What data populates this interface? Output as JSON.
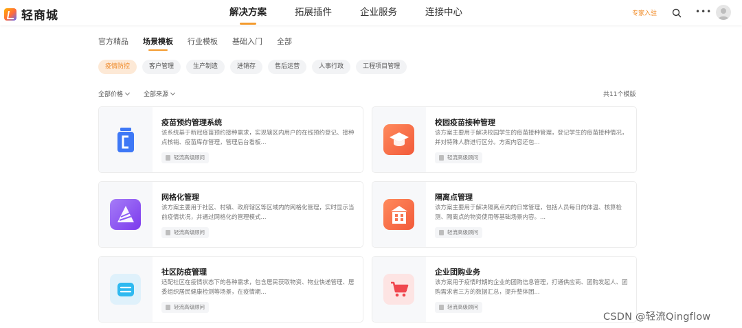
{
  "header": {
    "logo_text": "轻商城",
    "nav": [
      "解决方案",
      "拓展插件",
      "企业服务",
      "连接中心"
    ],
    "active_nav": 0,
    "expert_link": "专家入驻"
  },
  "category_tabs": [
    "官方精品",
    "场景模板",
    "行业模板",
    "基础入门",
    "全部"
  ],
  "active_category": 1,
  "chips": [
    "疫情防控",
    "客户管理",
    "生产制造",
    "进销存",
    "售后运营",
    "人事行政",
    "工程项目管理"
  ],
  "active_chip": 0,
  "filters": {
    "price": "全部价格",
    "source": "全部来源"
  },
  "count_text": "共11个模版",
  "cards": [
    {
      "title": "疫苗预约管理系统",
      "desc": "该系统基于新冠疫苗预约接种需求，实现辖区内用户的在线预约登记、接种点核销、疫苗库存管理，管理后台看板...",
      "tag": "轻流高级顾问",
      "icon": "vaccine-bottle-icon",
      "color": "#3e78f6"
    },
    {
      "title": "校园疫苗接种管理",
      "desc": "该方案主要用于解决校园学生的疫苗接种管理，登记学生的疫苗接种情况，并对特殊人群进行区分。方案内容还包...",
      "tag": "轻流高级顾问",
      "icon": "graduation-cap-icon",
      "color": "#f7734f"
    },
    {
      "title": "网格化管理",
      "desc": "该方案主要用于社区、村镇、政府辖区等区域内的网格化管理，实时显示当前疫情状况，并通过网格化的管理模式...",
      "tag": "轻流高级顾问",
      "icon": "grid-cone-icon",
      "color": "#8b5cf6"
    },
    {
      "title": "隔离点管理",
      "desc": "该方案主要用于解决隔离点内的日常管理，包括人员每日的体温、核算检测、隔离点的物资使用等基础场景内容。...",
      "tag": "轻流高级顾问",
      "icon": "building-icon",
      "color": "#f7734f"
    },
    {
      "title": "社区防疫管理",
      "desc": "适配社区在疫情状态下的各种需求，包含居民获取物资、物业快递管理、居委组织居民健康检测等场景，在疫情期...",
      "tag": "轻流高级顾问",
      "icon": "list-icon",
      "color": "#2fb9f0"
    },
    {
      "title": "企业团购业务",
      "desc": "该方案用于疫情时期的企业的团购信息管理，打通供应商、团购发起人、团购需求者三方的数据汇总，提升整体团...",
      "tag": "轻流高级顾问",
      "icon": "shopping-cart-icon",
      "color": "#f0474e"
    }
  ],
  "watermark": "CSDN @轻流Qingflow"
}
